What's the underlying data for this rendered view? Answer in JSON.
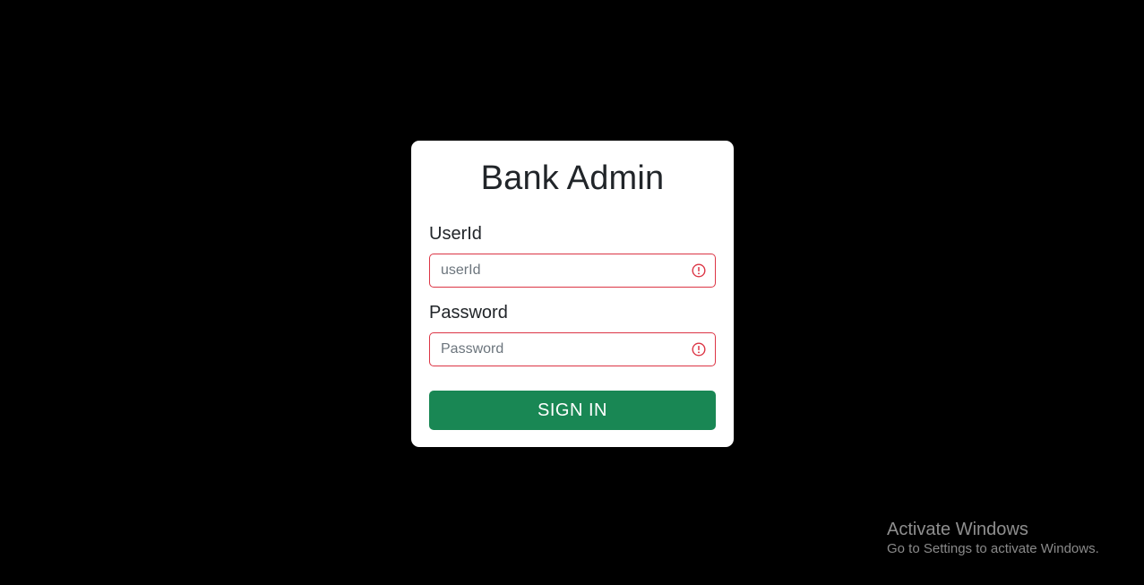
{
  "login": {
    "title": "Bank Admin",
    "userid_label": "UserId",
    "userid_placeholder": "userId",
    "userid_value": "",
    "password_label": "Password",
    "password_placeholder": "Password",
    "password_value": "",
    "signin_label": "SIGN IN"
  },
  "watermark": {
    "title": "Activate Windows",
    "subtitle": "Go to Settings to activate Windows."
  },
  "colors": {
    "background": "#000000",
    "card": "#ffffff",
    "invalid": "#dc3545",
    "button": "#198754",
    "button_text": "#ffffff"
  },
  "icons": {
    "invalid": "exclamation-circle-icon"
  }
}
